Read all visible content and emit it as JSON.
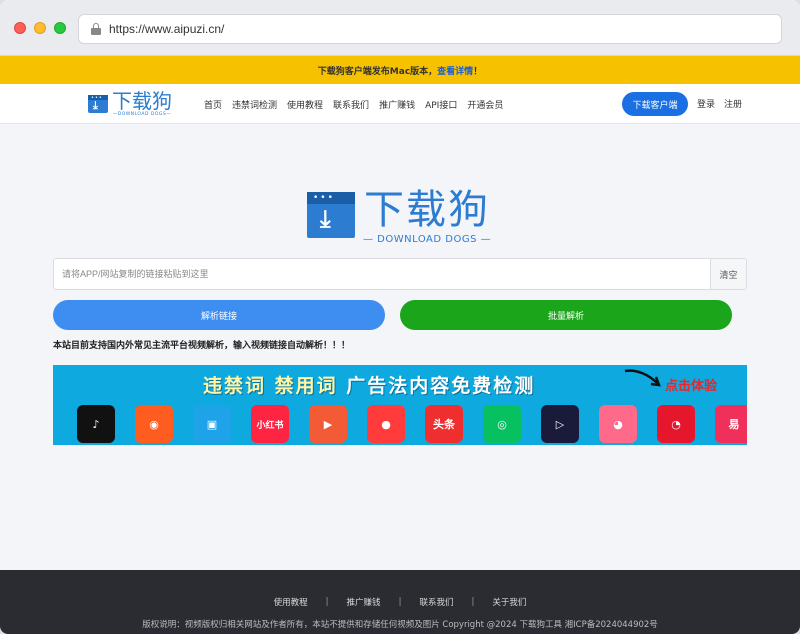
{
  "browser": {
    "url": "https://www.aipuzi.cn/"
  },
  "notice": {
    "text": "下载狗客户端发布Mac版本，",
    "link": "查看详情",
    "suffix": "！"
  },
  "header": {
    "logo_name": "下载狗",
    "logo_sub": "—DOWNLOAD DOGS—",
    "nav": [
      "首页",
      "违禁词检测",
      "使用教程",
      "联系我们",
      "推广赚钱",
      "API接口",
      "开通会员"
    ],
    "client_button": "下载客户端",
    "login": "登录",
    "register": "注册"
  },
  "hero": {
    "logo_name": "下载狗",
    "logo_sub": "— DOWNLOAD DOGS —",
    "search_placeholder": "请将APP/网站复制的链接粘贴到这里",
    "search_value": "",
    "clear": "清空",
    "parse_button": "解析链接",
    "batch_button": "批量解析",
    "support_text": "本站目前支持国内外常见主流平台视频解析，输入视频链接自动解析！！！"
  },
  "banner": {
    "title_a": "违禁词 禁用词",
    "title_b": " 广告法内容免费检测",
    "cta": "点击体验",
    "apps": [
      {
        "icon": "douyin-icon",
        "label": "♪",
        "color": "#111111"
      },
      {
        "icon": "kuaishou-icon",
        "label": "◉",
        "color": "#ff5c1f"
      },
      {
        "icon": "bilibili-icon",
        "label": "▣",
        "color": "#1fa3e8"
      },
      {
        "icon": "xiaohongshu-icon",
        "label": "小红书",
        "color": "#ff2442"
      },
      {
        "icon": "xigua-icon",
        "label": "▶",
        "color": "#f25b35"
      },
      {
        "icon": "weishi-icon",
        "label": "●",
        "color": "#ff3b3b"
      },
      {
        "icon": "toutiao-icon",
        "label": "头条",
        "color": "#ef2f2f"
      },
      {
        "icon": "wechat-video-icon",
        "label": "◎",
        "color": "#07c160"
      },
      {
        "icon": "haokan-icon",
        "label": "▷",
        "color": "#1a1a3a"
      },
      {
        "icon": "pipi-icon",
        "label": "◕",
        "color": "#ff6a8a"
      },
      {
        "icon": "weibo-icon",
        "label": "◔",
        "color": "#e6162d"
      },
      {
        "icon": "yi-icon",
        "label": "易",
        "color": "#f0305a"
      }
    ]
  },
  "footer": {
    "links": [
      "使用教程",
      "推广赚钱",
      "联系我们",
      "关于我们"
    ],
    "copyright": "版权说明：视频版权归相关网站及作者所有，本站不提供和存储任何视频及图片 Copyright @2024 下载狗工具 湘ICP备2024044902号"
  }
}
